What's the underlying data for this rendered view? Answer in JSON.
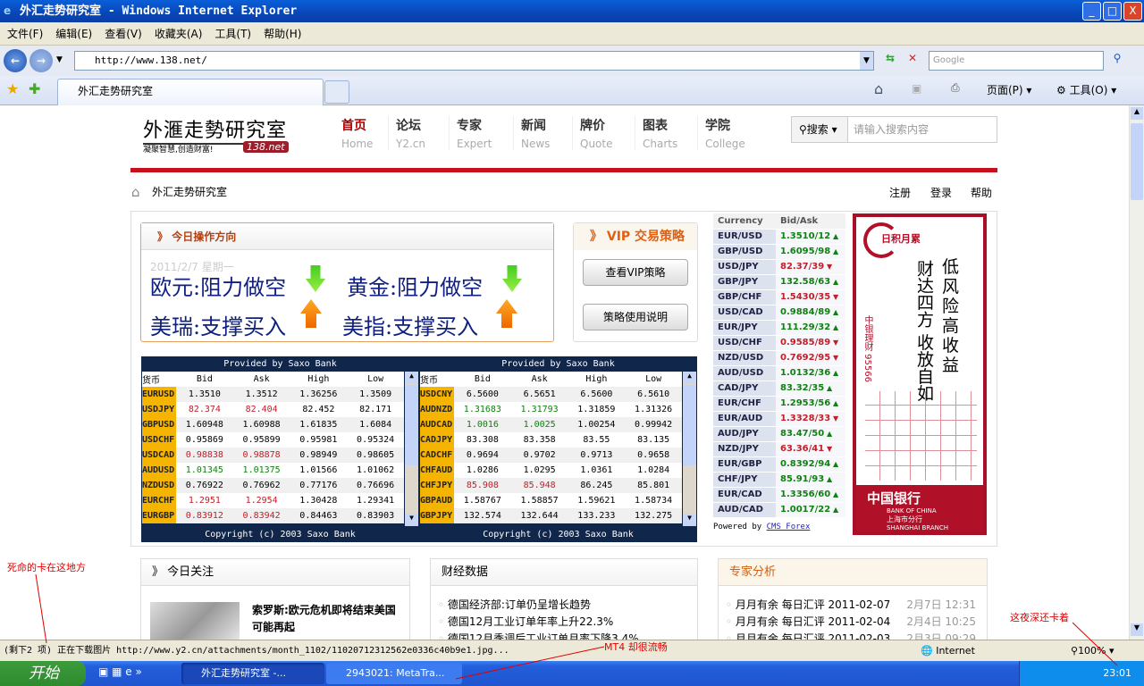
{
  "window": {
    "title": "外汇走势研究室 - Windows Internet Explorer",
    "min": "_",
    "max": "□",
    "close": "X"
  },
  "menu": [
    "文件(F)",
    "编辑(E)",
    "查看(V)",
    "收藏夹(A)",
    "工具(T)",
    "帮助(H)"
  ],
  "address": {
    "url": "http://www.138.net/",
    "search_placeholder": "Google"
  },
  "tabs": {
    "active": "外汇走势研究室",
    "page_menu": "页面(P)",
    "tools_menu": "工具(O)"
  },
  "site": {
    "logo": {
      "name": "外滙走勢研究室",
      "slogan": "凝聚智慧,创造财富!",
      "badge": "138.net"
    },
    "nav": [
      {
        "zh": "首页",
        "en": "Home"
      },
      {
        "zh": "论坛",
        "en": "Y2.cn"
      },
      {
        "zh": "专家",
        "en": "Expert"
      },
      {
        "zh": "新闻",
        "en": "News"
      },
      {
        "zh": "牌价",
        "en": "Quote"
      },
      {
        "zh": "图表",
        "en": "Charts"
      },
      {
        "zh": "学院",
        "en": "College"
      }
    ],
    "search": {
      "select": "搜索",
      "placeholder": "请输入搜索内容"
    },
    "breadcrumb": "外汇走势研究室",
    "toplinks": [
      "注册",
      "登录",
      "帮助"
    ],
    "today": {
      "title": "今日操作方向",
      "date": "2011/2/7 星期一",
      "items": [
        {
          "label": "欧元:阻力做空",
          "dir": "down"
        },
        {
          "label": "黄金:阻力做空",
          "dir": "down"
        },
        {
          "label": "美瑞:支撑买入",
          "dir": "up"
        },
        {
          "label": "美指:支撑买入",
          "dir": "up"
        }
      ]
    },
    "vip": {
      "title": "VIP 交易策略",
      "btn1": "查看VIP策略",
      "btn2": "策略使用说明"
    },
    "quotes": {
      "caption": "Provided by Saxo Bank",
      "copyright": "Copyright (c) 2003 Saxo Bank",
      "headers": [
        "货币",
        "Bid",
        "Ask",
        "High",
        "Low"
      ],
      "left": [
        [
          "EURUSD",
          "1.3510",
          "1.3512",
          "1.36256",
          "1.3509",
          ""
        ],
        [
          "USDJPY",
          "82.374",
          "82.404",
          "82.452",
          "82.171",
          "red"
        ],
        [
          "GBPUSD",
          "1.60948",
          "1.60988",
          "1.61835",
          "1.6084",
          ""
        ],
        [
          "USDCHF",
          "0.95869",
          "0.95899",
          "0.95981",
          "0.95324",
          ""
        ],
        [
          "USDCAD",
          "0.98838",
          "0.98878",
          "0.98949",
          "0.98605",
          "red"
        ],
        [
          "AUDUSD",
          "1.01345",
          "1.01375",
          "1.01566",
          "1.01062",
          "grn"
        ],
        [
          "NZDUSD",
          "0.76922",
          "0.76962",
          "0.77176",
          "0.76696",
          ""
        ],
        [
          "EURCHF",
          "1.2951",
          "1.2954",
          "1.30428",
          "1.29341",
          "red"
        ],
        [
          "EURGBP",
          "0.83912",
          "0.83942",
          "0.84463",
          "0.83903",
          "red"
        ]
      ],
      "right": [
        [
          "USDCNY",
          "6.5600",
          "6.5651",
          "6.5600",
          "6.5610",
          ""
        ],
        [
          "AUDNZD",
          "1.31683",
          "1.31793",
          "1.31859",
          "1.31326",
          "grn"
        ],
        [
          "AUDCAD",
          "1.0016",
          "1.0025",
          "1.00254",
          "0.99942",
          "grn"
        ],
        [
          "CADJPY",
          "83.308",
          "83.358",
          "83.55",
          "83.135",
          ""
        ],
        [
          "CADCHF",
          "0.9694",
          "0.9702",
          "0.9713",
          "0.9658",
          ""
        ],
        [
          "CHFAUD",
          "1.0286",
          "1.0295",
          "1.0361",
          "1.0284",
          ""
        ],
        [
          "CHFJPY",
          "85.908",
          "85.948",
          "86.245",
          "85.801",
          "red"
        ],
        [
          "GBPAUD",
          "1.58767",
          "1.58857",
          "1.59621",
          "1.58734",
          ""
        ],
        [
          "GBPJPY",
          "132.574",
          "132.644",
          "133.233",
          "132.275",
          ""
        ]
      ]
    },
    "currency": {
      "headers": [
        "Currency",
        "Bid/Ask"
      ],
      "rows": [
        [
          "EUR/USD",
          "1.3510/12",
          "up"
        ],
        [
          "GBP/USD",
          "1.6095/98",
          "up"
        ],
        [
          "USD/JPY",
          "82.37/39",
          "down"
        ],
        [
          "GBP/JPY",
          "132.58/63",
          "up"
        ],
        [
          "GBP/CHF",
          "1.5430/35",
          "down"
        ],
        [
          "USD/CAD",
          "0.9884/89",
          "up"
        ],
        [
          "EUR/JPY",
          "111.29/32",
          "up"
        ],
        [
          "USD/CHF",
          "0.9585/89",
          "down"
        ],
        [
          "NZD/USD",
          "0.7692/95",
          "down"
        ],
        [
          "AUD/USD",
          "1.0132/36",
          "up"
        ],
        [
          "CAD/JPY",
          "83.32/35",
          "up"
        ],
        [
          "EUR/CHF",
          "1.2953/56",
          "up"
        ],
        [
          "EUR/AUD",
          "1.3328/33",
          "down"
        ],
        [
          "AUD/JPY",
          "83.47/50",
          "up"
        ],
        [
          "NZD/JPY",
          "63.36/41",
          "down"
        ],
        [
          "EUR/GBP",
          "0.8392/94",
          "up"
        ],
        [
          "CHF/JPY",
          "85.91/93",
          "up"
        ],
        [
          "EUR/CAD",
          "1.3356/60",
          "up"
        ],
        [
          "AUD/CAD",
          "1.0017/22",
          "up"
        ]
      ],
      "powered": "Powered by",
      "powered_link": "CMS Forex",
      "up_color": "#108010",
      "down_color": "#c0202a"
    },
    "ad": {
      "brand": "日积月累",
      "line1": "低风险 高收益",
      "line2": "财达四方 收放自如",
      "side": "中银理财 95566",
      "bank": "中国银行",
      "bank_en": "BANK OF CHINA",
      "branch": "上海市分行",
      "branch_en": "SHANGHAI BRANCH"
    },
    "focus": {
      "title": "今日关注",
      "headline": "索罗斯:欧元危机即将结束美国可能再起"
    },
    "econ": {
      "title": "财经数据",
      "items": [
        "德国经济部:订单仍呈增长趋势",
        "德国12月工业订单年率上升22.3%",
        "德国12月季调后工业订单月率下降3.4%"
      ]
    },
    "expert": {
      "title": "专家分析",
      "items": [
        {
          "t": "月月有余 每日汇评 2011-02-07",
          "d": "2月7日 12:31"
        },
        {
          "t": "月月有余 每日汇评 2011-02-04",
          "d": "2月4日 10:25"
        },
        {
          "t": "月月有余 每日汇评 2011-02-03",
          "d": "2月3日 09:29"
        }
      ]
    }
  },
  "status": {
    "text": "(剩下2 项) 正在下载图片 http://www.y2.cn/attachments/month_1102/11020712312562e0336c40b9e1.jpg...",
    "zone": "Internet",
    "zoom": "100%"
  },
  "taskbar": {
    "start": "开始",
    "tasks": [
      "外汇走势研究室 -...",
      "2943021: MetaTra..."
    ],
    "clock": "23:01"
  },
  "annotations": [
    "死命的卡在这地方",
    "MT4 却很流畅",
    "这夜深还卡着"
  ]
}
